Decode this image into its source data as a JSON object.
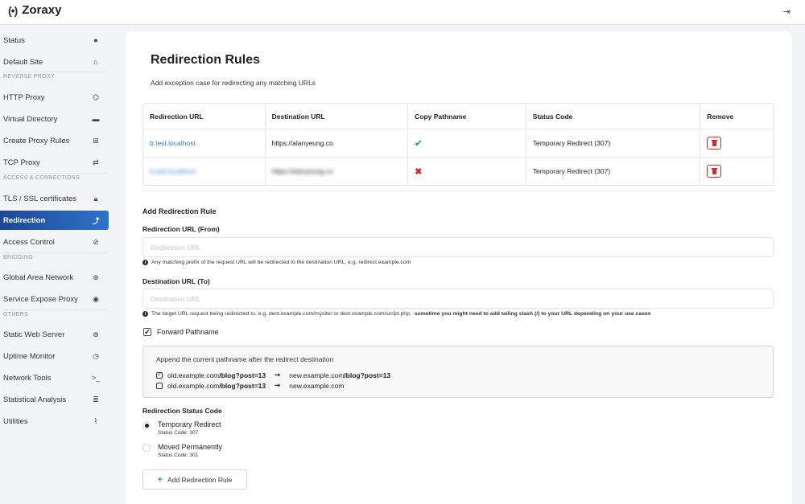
{
  "app": {
    "logo_glyph": "(•)",
    "name": "Zoraxy",
    "logout_icon": "⇥"
  },
  "sidebar": {
    "items": [
      {
        "label": "Status",
        "icon": "info-icon",
        "glyph": "●"
      },
      {
        "label": "Default Site",
        "icon": "home-icon",
        "glyph": "⌂"
      },
      {
        "section": "REVERSE PROXY"
      },
      {
        "label": "HTTP Proxy",
        "icon": "sitemap-icon",
        "glyph": "⌬"
      },
      {
        "label": "Virtual Directory",
        "icon": "folder-icon",
        "glyph": "▬"
      },
      {
        "label": "Create Proxy Rules",
        "icon": "plus-square-icon",
        "glyph": "⊞"
      },
      {
        "label": "TCP Proxy",
        "icon": "exchange-icon",
        "glyph": "⇄"
      },
      {
        "section": "ACCESS & CONNECTIONS"
      },
      {
        "label": "TLS / SSL certificates",
        "icon": "lock-icon",
        "glyph": "🔒︎"
      },
      {
        "label": "Redirection",
        "icon": "level-up-icon",
        "glyph": "⤴",
        "active": true
      },
      {
        "label": "Access Control",
        "icon": "ban-icon",
        "glyph": "⊘"
      },
      {
        "section": "BRIDGING"
      },
      {
        "label": "Global Area Network",
        "icon": "globe-icon",
        "glyph": "⊕"
      },
      {
        "label": "Service Expose Proxy",
        "icon": "podcast-icon",
        "glyph": "◉"
      },
      {
        "section": "OTHERS"
      },
      {
        "label": "Static Web Server",
        "icon": "globe-icon",
        "glyph": "⊕"
      },
      {
        "label": "Uptime Monitor",
        "icon": "clock-icon",
        "glyph": "◷"
      },
      {
        "label": "Network Tools",
        "icon": "terminal-icon",
        "glyph": ">_"
      },
      {
        "label": "Statistical Analysis",
        "icon": "database-icon",
        "glyph": "≣"
      },
      {
        "label": "Utilities",
        "icon": "paperclip-icon",
        "glyph": "⌇"
      }
    ]
  },
  "main": {
    "title": "Redirection Rules",
    "subtitle": "Add exception case for redirecting any matching URLs",
    "table": {
      "headers": [
        "Redirection URL",
        "Destination URL",
        "Copy Pathname",
        "Status Code",
        "Remove"
      ],
      "rows": [
        {
          "redirect_url": "b.test.localhost",
          "destination_url": "https://alanyeung.co",
          "copy_pathname": "✔",
          "copy_pathname_icon": "check-icon",
          "status_code": "Temporary Redirect (307)",
          "blurred": false
        },
        {
          "redirect_url": "b.test.localhost",
          "destination_url": "https://alanyeung.co",
          "copy_pathname": "✖",
          "copy_pathname_icon": "times-icon",
          "status_code": "Temporary Redirect (307)",
          "blurred": true
        }
      ]
    },
    "form": {
      "section_title": "Add Redirection Rule",
      "from_label": "Redirection URL (From)",
      "from_placeholder": "Redirection URL",
      "from_value": "",
      "from_hint": "Any matching prefix of the request URL will be redirected to the destination URL, e.g. redirect.example.com",
      "to_label": "Destination URL (To)",
      "to_placeholder": "Destination URL",
      "to_value": "",
      "to_hint_normal": "The target URL request being redirected to, e.g. dest.example.com/mysite/ or dest.example.com/script.php,",
      "to_hint_bold": "sometime you might need to add tailing slash (/) to your URL depending on your use cases",
      "forward_label": "Forward Pathname",
      "forward_checked": true,
      "info_title": "Append the current pathname after the redirect destination",
      "example_1": {
        "checked": true,
        "from_host": "old.example.com",
        "from_path": "/blog?post=13",
        "arrow": "➞",
        "to_host": "new.example.com",
        "to_path": "/blog?post=13"
      },
      "example_2": {
        "checked": false,
        "from_host": "old.example.com",
        "from_path": "/blog?post=13",
        "arrow": "➞",
        "to_host": "new.example.com",
        "to_path": ""
      },
      "status_title": "Redirection Status Code",
      "status_options": [
        {
          "label": "Temporary Redirect",
          "sub": "Status Code: 307",
          "checked": true
        },
        {
          "label": "Moved Permanently",
          "sub": "Status Code: 301",
          "checked": false
        }
      ],
      "add_button": "Add Redirection Rule"
    }
  },
  "colors": {
    "accent": "#1f5aa8",
    "link": "#3a7bd5",
    "success": "#21ba45",
    "danger": "#db2828"
  }
}
